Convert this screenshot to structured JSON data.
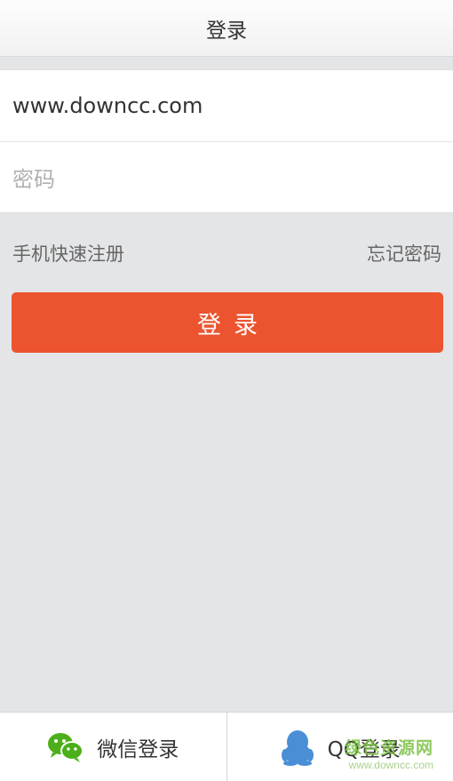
{
  "header": {
    "title": "登录"
  },
  "form": {
    "username_value": "www.downcc.com",
    "password_placeholder": "密码"
  },
  "links": {
    "register": "手机快速注册",
    "forgot": "忘记密码"
  },
  "login_button": {
    "label": "登录"
  },
  "footer": {
    "wechat": {
      "label": "微信登录",
      "icon": "wechat-icon"
    },
    "qq": {
      "label": "QQ登录",
      "icon": "qq-icon"
    }
  },
  "watermark": {
    "main": "绿色资源网",
    "sub": "www.downcc.com"
  },
  "colors": {
    "accent": "#ec542f",
    "background": "#e4e5e7",
    "wechat": "#4caf1a",
    "qq": "#4a8fd6"
  }
}
